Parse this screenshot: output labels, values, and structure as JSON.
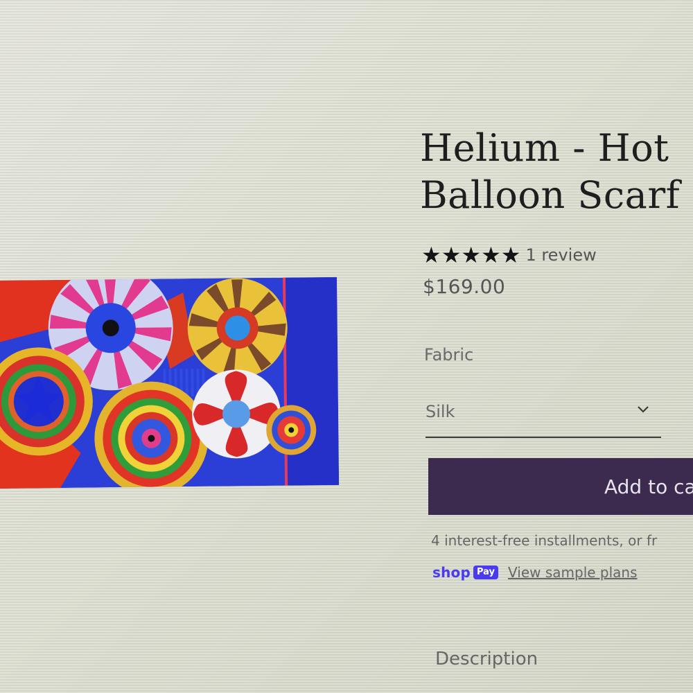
{
  "product": {
    "title_line1": "Helium - Hot",
    "title_line2": "Balloon Scarf",
    "rating_stars": "★★★★★",
    "rating_value": 5,
    "review_count": "1 review",
    "price": "$169.00"
  },
  "options": {
    "fabric_label": "Fabric",
    "fabric_selected": "Silk"
  },
  "actions": {
    "add_to_cart_label": "Add to cart"
  },
  "payment": {
    "installments_text": "4 interest-free installments, or fr",
    "shop_word": "shop",
    "pay_badge": "Pay",
    "sample_plans_link": "View sample plans"
  },
  "tabs": {
    "description": "Description"
  },
  "colors": {
    "button_bg": "#3c2a4f",
    "shop_pay_blue": "#4a3bf0"
  },
  "icons": {
    "dropdown": "chevron-down-icon"
  }
}
